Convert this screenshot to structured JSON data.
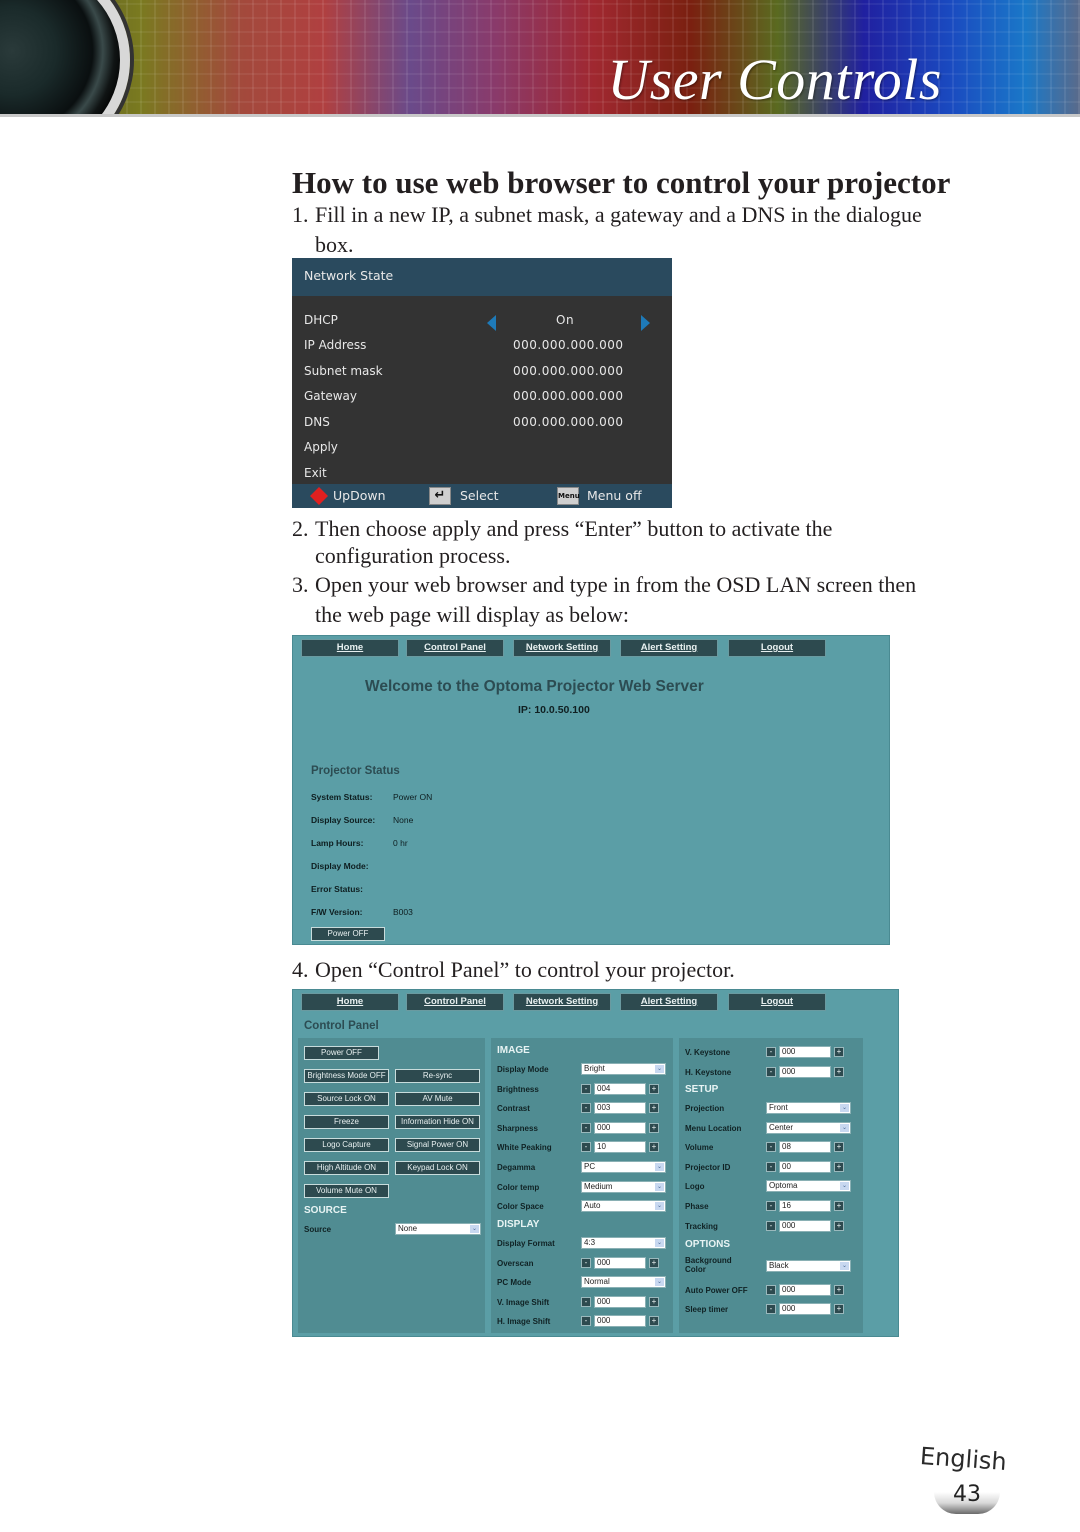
{
  "header": {
    "title": "User Controls"
  },
  "section": {
    "title": "How to use web browser to control your projector",
    "steps": [
      {
        "num": "1.",
        "line1": "Fill in a new IP, a subnet mask, a gateway and a DNS in the dialogue",
        "line2": "box."
      },
      {
        "num": "2.",
        "line1": "Then choose apply and press “Enter” button to activate the",
        "line2": "configuration process."
      },
      {
        "num": "3.",
        "line1": "Open your web browser and type in from the OSD LAN screen then",
        "line2": "the web page will display as below:"
      },
      {
        "num": "4.",
        "line1": "Open “Control Panel” to control your projector."
      }
    ]
  },
  "osd": {
    "title": "Network State",
    "rows": [
      {
        "label": "DHCP",
        "value": "On"
      },
      {
        "label": "IP Address",
        "value": "000.000.000.000"
      },
      {
        "label": "Subnet mask",
        "value": "000.000.000.000"
      },
      {
        "label": "Gateway",
        "value": "000.000.000.000"
      },
      {
        "label": "DNS",
        "value": "000.000.000.000"
      },
      {
        "label": "Apply"
      },
      {
        "label": "Exit"
      }
    ],
    "footer": {
      "updown": "UpDown",
      "select": "Select",
      "menu_icon": "Menu",
      "menu_off": "Menu off",
      "enter_icon": "↵"
    },
    "colors": {
      "header": "#2a4a5e",
      "body": "#333333",
      "arrow": "#1e7ab8",
      "updown": "#e02020"
    }
  },
  "nav": [
    "Home",
    "Control Panel",
    "Network Setting",
    "Alert Setting",
    "Logout"
  ],
  "home_page": {
    "welcome": "Welcome to the Optoma Projector Web Server",
    "ip": "IP: 10.0.50.100",
    "status_title": "Projector Status",
    "status": [
      {
        "key": "System Status:",
        "value": "Power ON"
      },
      {
        "key": "Display Source:",
        "value": "None"
      },
      {
        "key": "Lamp Hours:",
        "value": "0 hr"
      },
      {
        "key": "Display Mode:",
        "value": ""
      },
      {
        "key": "Error Status:",
        "value": ""
      },
      {
        "key": "F/W Version:",
        "value": "B003"
      }
    ],
    "power_button": "Power OFF"
  },
  "control_panel": {
    "title": "Control Panel",
    "buttons": {
      "power_off": "Power OFF",
      "grid": [
        [
          "Brightness Mode OFF",
          "Re-sync"
        ],
        [
          "Source Lock ON",
          "AV Mute"
        ],
        [
          "Freeze",
          "Information Hide ON"
        ],
        [
          "Logo Capture",
          "Signal Power ON"
        ],
        [
          "High Altitude ON",
          "Keypad Lock ON"
        ],
        [
          "Volume Mute ON"
        ]
      ]
    },
    "source": {
      "heading": "SOURCE",
      "label": "Source",
      "value": "None"
    },
    "image": {
      "heading": "IMAGE",
      "rows": [
        {
          "label": "Display Mode",
          "type": "select",
          "value": "Bright"
        },
        {
          "label": "Brightness",
          "type": "stepper",
          "value": "004"
        },
        {
          "label": "Contrast",
          "type": "stepper",
          "value": "003"
        },
        {
          "label": "Sharpness",
          "type": "stepper",
          "value": "000"
        },
        {
          "label": "White Peaking",
          "type": "stepper",
          "value": "10"
        },
        {
          "label": "Degamma",
          "type": "select",
          "value": "PC"
        },
        {
          "label": "Color temp",
          "type": "select",
          "value": "Medium"
        },
        {
          "label": "Color Space",
          "type": "select",
          "value": "Auto"
        }
      ]
    },
    "display": {
      "heading": "DISPLAY",
      "rows": [
        {
          "label": "Display Format",
          "type": "select",
          "value": "4:3"
        },
        {
          "label": "Overscan",
          "type": "stepper",
          "value": "000"
        },
        {
          "label": "PC Mode",
          "type": "select",
          "value": "Normal"
        },
        {
          "label": "V. Image Shift",
          "type": "stepper",
          "value": "000"
        },
        {
          "label": "H. Image Shift",
          "type": "stepper",
          "value": "000"
        }
      ]
    },
    "keystone": [
      {
        "label": "V. Keystone",
        "type": "stepper",
        "value": "000"
      },
      {
        "label": "H. Keystone",
        "type": "stepper",
        "value": "000"
      }
    ],
    "setup": {
      "heading": "SETUP",
      "rows": [
        {
          "label": "Projection",
          "type": "select",
          "value": "Front"
        },
        {
          "label": "Menu Location",
          "type": "select",
          "value": "Center"
        },
        {
          "label": "Volume",
          "type": "stepper",
          "value": "08"
        },
        {
          "label": "Projector ID",
          "type": "stepper",
          "value": "00"
        },
        {
          "label": "Logo",
          "type": "select",
          "value": "Optoma"
        },
        {
          "label": "Phase",
          "type": "stepper",
          "value": "16"
        },
        {
          "label": "Tracking",
          "type": "stepper",
          "value": "000"
        }
      ]
    },
    "options": {
      "heading": "OPTIONS",
      "rows": [
        {
          "label": "Background Color",
          "type": "select",
          "value": "Black"
        },
        {
          "label": "Auto Power OFF",
          "type": "stepper",
          "value": "000"
        },
        {
          "label": "Sleep timer",
          "type": "stepper",
          "value": "000"
        }
      ]
    },
    "stepper_minus": "-",
    "stepper_plus": "+",
    "caret": "⌄"
  },
  "footer": {
    "language": "English",
    "page": "43"
  }
}
